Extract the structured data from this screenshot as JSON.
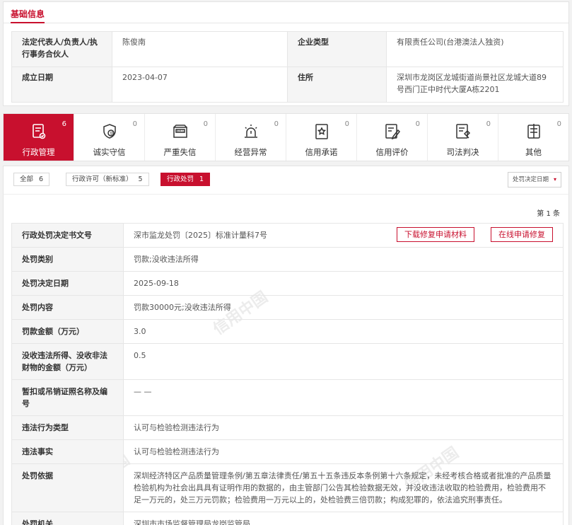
{
  "basic_info": {
    "title": "基础信息",
    "rows": [
      {
        "k1": "法定代表人/负责人/执行事务合伙人",
        "v1": "陈俊南",
        "k2": "企业类型",
        "v2": "有限责任公司(台港澳法人独资)"
      },
      {
        "k1": "成立日期",
        "v1": "2023-04-07",
        "k2": "住所",
        "v2": "深圳市龙岗区龙城街道尚景社区龙城大道89号西门正中时代大厦A栋2201"
      }
    ]
  },
  "tabs": [
    {
      "label": "行政管理",
      "count": "6",
      "icon": "admin-doc-icon"
    },
    {
      "label": "诚实守信",
      "count": "0",
      "icon": "shield-badge-icon"
    },
    {
      "label": "严重失信",
      "count": "0",
      "icon": "dishonest-list-icon"
    },
    {
      "label": "经营异常",
      "count": "0",
      "icon": "alarm-icon"
    },
    {
      "label": "信用承诺",
      "count": "0",
      "icon": "promise-doc-icon"
    },
    {
      "label": "信用评价",
      "count": "0",
      "icon": "evaluation-icon"
    },
    {
      "label": "司法判决",
      "count": "0",
      "icon": "judgment-icon"
    },
    {
      "label": "其他",
      "count": "0",
      "icon": "other-icon"
    }
  ],
  "filters": {
    "chips": [
      {
        "label": "全部",
        "count": "6"
      },
      {
        "label": "行政许可（新标准）",
        "count": "5"
      },
      {
        "label": "行政处罚",
        "count": "1"
      }
    ],
    "sort_label": "处罚决定日期",
    "sort_arrow": "▾"
  },
  "detail": {
    "record_count": "第 1 条",
    "watermark": "信用中国",
    "download_button": "下载修复申请材料",
    "repair_button": "在线申请修复",
    "rows": [
      {
        "k": "行政处罚决定书文号",
        "v": "深市监龙处罚〔2025〕标准计量科7号"
      },
      {
        "k": "处罚类别",
        "v": "罚款;没收违法所得"
      },
      {
        "k": "处罚决定日期",
        "v": "2025-09-18"
      },
      {
        "k": "处罚内容",
        "v": "罚款30000元;没收违法所得"
      },
      {
        "k": "罚款金额（万元）",
        "v": "3.0"
      },
      {
        "k": "没收违法所得、没收非法财物的金额（万元）",
        "v": "0.5"
      },
      {
        "k": "暂扣或吊销证照名称及编号",
        "v": "— —"
      },
      {
        "k": "违法行为类型",
        "v": "认可与检验检测违法行为"
      },
      {
        "k": "违法事实",
        "v": "认可与检验检测违法行为"
      },
      {
        "k": "处罚依据",
        "v": "深圳经济特区产品质量管理条例/第五章法律责任/第五十五条违反本条例第十六条规定，未经考核合格或者批准的产品质量检验机构为社会出具具有证明作用的数据的，由主管部门公告其检验数据无效，并没收违法收取的检验费用，检验费用不足一万元的，处三万元罚款；检验费用一万元以上的，处检验费三倍罚款；构成犯罪的，依法追究刑事责任。"
      },
      {
        "k": "处罚机关",
        "v": "深圳市市场监督管理局龙岗监管局"
      }
    ]
  },
  "colors": {
    "accent": "#c8102e",
    "label_bg": "#f5f5f5",
    "border": "#e6e6e6"
  }
}
